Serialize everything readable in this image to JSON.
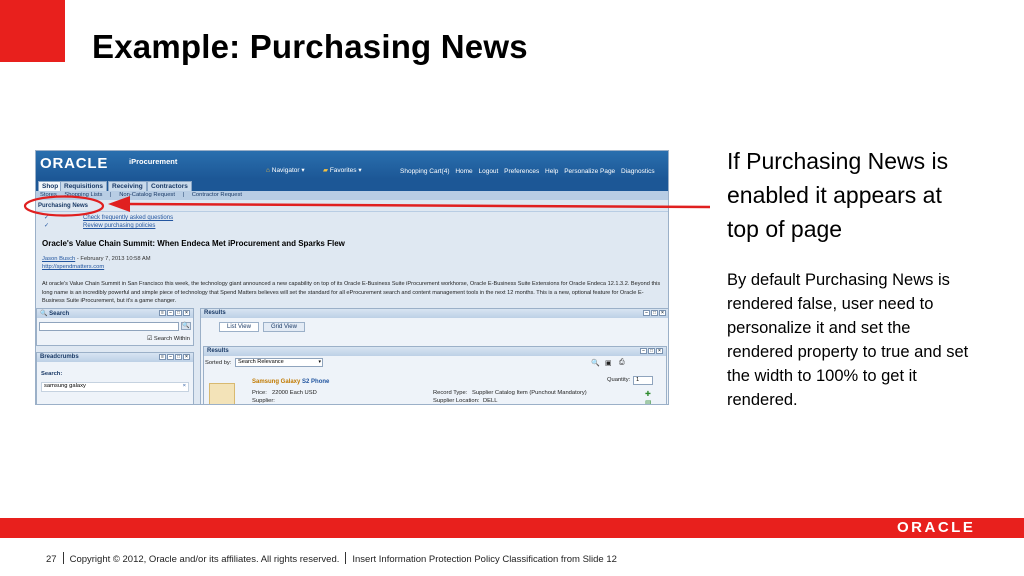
{
  "slide": {
    "title": "Example:  Purchasing News",
    "side_p1": "If Purchasing News is enabled it appears at top of page",
    "side_p2": "By default Purchasing News is rendered false, user need to personalize it and set the rendered property to true and set the width to 100% to get it rendered.",
    "footer_logo": "ORACLE",
    "page_number": "27",
    "copyright": "Copyright © 2012, Oracle and/or its affiliates. All rights reserved.",
    "classification": "Insert Information Protection Policy Classification from Slide 12"
  },
  "colors": {
    "accent_red": "#e8201d",
    "oracle_blue": "#1c5796",
    "annotation_red": "#e02020"
  },
  "app": {
    "logo": "ORACLE",
    "name": "iProcurement",
    "navigator": "Navigator",
    "favorites": "Favorites",
    "global_links": [
      "Shopping Cart(4)",
      "Home",
      "Logout",
      "Preferences",
      "Help",
      "Personalize Page",
      "Diagnostics"
    ],
    "tabs": [
      "Shop",
      "Requisitions",
      "Receiving",
      "Contractors"
    ],
    "subtabs": [
      "Stores",
      "Shopping Lists",
      "|",
      "Non-Catalog Request",
      "|",
      "Contractor Request"
    ]
  },
  "news": {
    "header": "Purchasing News",
    "links": [
      "Check frequently asked questions",
      "Review purchasing policies"
    ],
    "headline": "Oracle's Value Chain Summit: When Endeca Met iProcurement and Sparks Flew",
    "author": "Jason Busch",
    "date": " - February 7, 2013 10:58 AM",
    "url": "http://spendmatters.com",
    "body": "At oracle's Value Chain Summit in San Francisco this week, the technology giant announced a new capability on top of its Oracle E-Business Suite iProcurement workhorse, Oracle E-Business Suite Extensions for Oracle Endeca 12.1.3.2. Beyond this long name is an incredibly powerful and simple piece of technology that Spend Matters believes will set the standard for all eProcurement search and content management tools in the next 12 months. This is a new, optional feature for Oracle E-Business Suite iProcurement, but it's a game changer."
  },
  "search": {
    "header": "Search",
    "within": "Search Within"
  },
  "breadcrumbs": {
    "header": "Breadcrumbs",
    "label": "Search:",
    "value": "samsung galaxy"
  },
  "results": {
    "header": "Results",
    "list_view": "List View",
    "grid_view": "Grid View",
    "inner_header": "Results",
    "sorted_by": "Sorted by:",
    "sort_value": "Search Relevance",
    "quantity": "Quantity:",
    "quantity_value": "1",
    "product_name_hl": "Samsung Galaxy",
    "product_name_rest": " S2 Phone",
    "price_label": "Price:",
    "price": "22000 Each USD",
    "supplier_label": "Supplier:",
    "record_type_label": "Record Type:",
    "record_type": "Supplier Catalog Item (Punchout Mandatory)",
    "supplier_location_label": "Supplier Location:",
    "supplier_location": "DELL"
  }
}
